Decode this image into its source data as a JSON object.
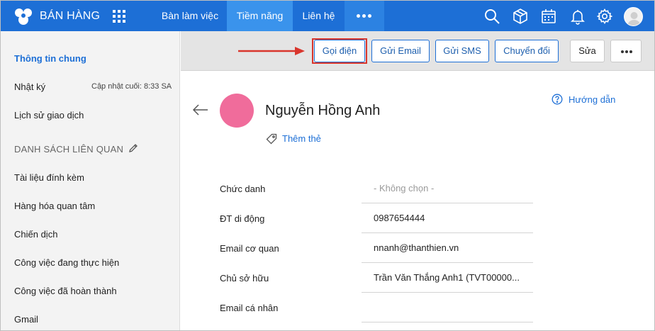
{
  "brand": {
    "name": "BÁN HÀNG",
    "icon": "logo-flower-icon"
  },
  "nav": {
    "tabs": [
      {
        "label": "Bàn làm việc",
        "active": false
      },
      {
        "label": "Tiềm năng",
        "active": true
      },
      {
        "label": "Liên hệ",
        "active": false
      }
    ],
    "more_icon": "more-dots-icon"
  },
  "top_icons": [
    "search-icon",
    "box-icon",
    "calendar-icon",
    "bell-icon",
    "gear-icon",
    "user-avatar"
  ],
  "sidebar": {
    "items": [
      {
        "label": "Thông tin chung",
        "active": true
      },
      {
        "label": "Nhật ký",
        "meta": "Cập nhật cuối: 8:33 SA"
      },
      {
        "label": "Lịch sử giao dịch"
      }
    ],
    "section_title": "DANH SÁCH LIÊN QUAN",
    "related_items": [
      {
        "label": "Tài liệu đính kèm"
      },
      {
        "label": "Hàng hóa quan tâm"
      },
      {
        "label": "Chiến dịch"
      },
      {
        "label": "Công việc đang thực hiện"
      },
      {
        "label": "Công việc đã hoàn thành"
      },
      {
        "label": "Gmail"
      }
    ]
  },
  "toolbar": {
    "call_label": "Gọi điện",
    "email_label": "Gửi Email",
    "sms_label": "Gửi SMS",
    "convert_label": "Chuyển đổi",
    "edit_label": "Sửa",
    "more_icon": "more-dots-icon"
  },
  "contact": {
    "name": "Nguyễn Hồng Anh",
    "add_tag_label": "Thêm thẻ",
    "help_label": "Hướng dẫn",
    "avatar_color": "#f06c9b"
  },
  "fields": [
    {
      "label": "Chức danh",
      "value": "- Không chọn -",
      "placeholder": true
    },
    {
      "label": "ĐT di động",
      "value": "0987654444"
    },
    {
      "label": "Email cơ quan",
      "value": "nnanh@thanthien.vn"
    },
    {
      "label": "Chủ sở hữu",
      "value": "Trần Văn Thắng Anh1 (TVT00000..."
    },
    {
      "label": "Email cá nhân",
      "value": ""
    }
  ],
  "colors": {
    "primary": "#1d6fd6",
    "active_tab": "#3a93ec",
    "highlight": "#d9362d"
  }
}
